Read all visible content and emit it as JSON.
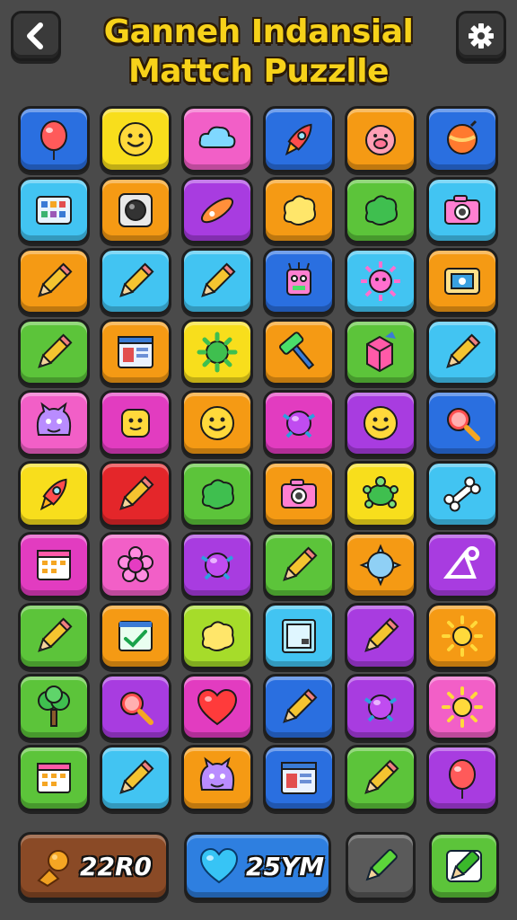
{
  "header": {
    "title_line1": "Ganneh Indansial",
    "title_line2": "Mattch Puzzlle",
    "back_icon": "back-arrow-icon",
    "settings_icon": "gear-icon"
  },
  "tile_colors": {
    "blue": "#2a6fe0",
    "yellow": "#f8de1c",
    "pink": "#f25fc7",
    "orange": "#f59a14",
    "cyan": "#42c4f2",
    "purple": "#a83ce0",
    "green": "#5cc43a",
    "red": "#e4262a",
    "lime": "#a6dc2a",
    "magenta": "#e23cc0"
  },
  "board": [
    [
      {
        "color": "blue",
        "icon": "balloon-icon"
      },
      {
        "color": "yellow",
        "icon": "smiley-face-icon"
      },
      {
        "color": "pink",
        "icon": "cloud-icon"
      },
      {
        "color": "blue",
        "icon": "rocket-icon"
      },
      {
        "color": "orange",
        "icon": "pig-face-icon"
      },
      {
        "color": "blue",
        "icon": "spinning-top-icon"
      }
    ],
    [
      {
        "color": "cyan",
        "icon": "app-grid-icon"
      },
      {
        "color": "orange",
        "icon": "camera-lens-icon"
      },
      {
        "color": "purple",
        "icon": "missile-icon"
      },
      {
        "color": "orange",
        "icon": "blob-icon"
      },
      {
        "color": "green",
        "icon": "green-blob-icon"
      },
      {
        "color": "cyan",
        "icon": "camera-icon"
      }
    ],
    [
      {
        "color": "orange",
        "icon": "pencil-icon"
      },
      {
        "color": "cyan",
        "icon": "pencil-icon"
      },
      {
        "color": "cyan",
        "icon": "pencil-icon"
      },
      {
        "color": "blue",
        "icon": "robot-icon"
      },
      {
        "color": "cyan",
        "icon": "sun-face-icon"
      },
      {
        "color": "orange",
        "icon": "screen-icon"
      }
    ],
    [
      {
        "color": "green",
        "icon": "pencil-icon"
      },
      {
        "color": "orange",
        "icon": "window-icon"
      },
      {
        "color": "yellow",
        "icon": "gear-burst-icon"
      },
      {
        "color": "orange",
        "icon": "hammer-icon"
      },
      {
        "color": "green",
        "icon": "cube-icon"
      },
      {
        "color": "cyan",
        "icon": "pencil-icon"
      }
    ],
    [
      {
        "color": "pink",
        "icon": "monster-icon"
      },
      {
        "color": "magenta",
        "icon": "smiley-block-icon"
      },
      {
        "color": "orange",
        "icon": "smiley-face-icon"
      },
      {
        "color": "magenta",
        "icon": "orb-icon"
      },
      {
        "color": "purple",
        "icon": "smiley-face-icon"
      },
      {
        "color": "blue",
        "icon": "magnifier-icon"
      }
    ],
    [
      {
        "color": "yellow",
        "icon": "rocket-icon"
      },
      {
        "color": "red",
        "icon": "pencil-icon"
      },
      {
        "color": "green",
        "icon": "green-blob-icon"
      },
      {
        "color": "orange",
        "icon": "camera-icon"
      },
      {
        "color": "yellow",
        "icon": "turtle-icon"
      },
      {
        "color": "cyan",
        "icon": "bone-icon"
      }
    ],
    [
      {
        "color": "magenta",
        "icon": "calendar-icon"
      },
      {
        "color": "pink",
        "icon": "flower-icon"
      },
      {
        "color": "purple",
        "icon": "orb-icon"
      },
      {
        "color": "green",
        "icon": "pencil-icon"
      },
      {
        "color": "orange",
        "icon": "spiky-ball-icon"
      },
      {
        "color": "purple",
        "icon": "triangle-tool-icon"
      }
    ],
    [
      {
        "color": "green",
        "icon": "pencil-icon"
      },
      {
        "color": "orange",
        "icon": "checkbox-icon"
      },
      {
        "color": "lime",
        "icon": "blob-icon"
      },
      {
        "color": "cyan",
        "icon": "photo-frame-icon"
      },
      {
        "color": "purple",
        "icon": "pencil-icon"
      },
      {
        "color": "orange",
        "icon": "sun-icon"
      }
    ],
    [
      {
        "color": "green",
        "icon": "tree-icon"
      },
      {
        "color": "purple",
        "icon": "magnifier-icon"
      },
      {
        "color": "magenta",
        "icon": "heart-icon"
      },
      {
        "color": "blue",
        "icon": "pencil-icon"
      },
      {
        "color": "purple",
        "icon": "orb-icon"
      },
      {
        "color": "pink",
        "icon": "sun-icon"
      }
    ],
    [
      {
        "color": "green",
        "icon": "calendar-icon"
      },
      {
        "color": "cyan",
        "icon": "pencil-icon"
      },
      {
        "color": "orange",
        "icon": "monster-icon"
      },
      {
        "color": "blue",
        "icon": "window-icon"
      },
      {
        "color": "green",
        "icon": "pencil-icon"
      },
      {
        "color": "purple",
        "icon": "balloon-icon"
      }
    ]
  ],
  "footer": {
    "coins": {
      "value": "22R0",
      "icon": "hand-coin-icon"
    },
    "lives": {
      "value": "25YM",
      "icon": "heart-icon"
    },
    "boost_1": {
      "icon": "green-pencil-icon"
    },
    "boost_2": {
      "icon": "green-pencil-icon"
    }
  }
}
